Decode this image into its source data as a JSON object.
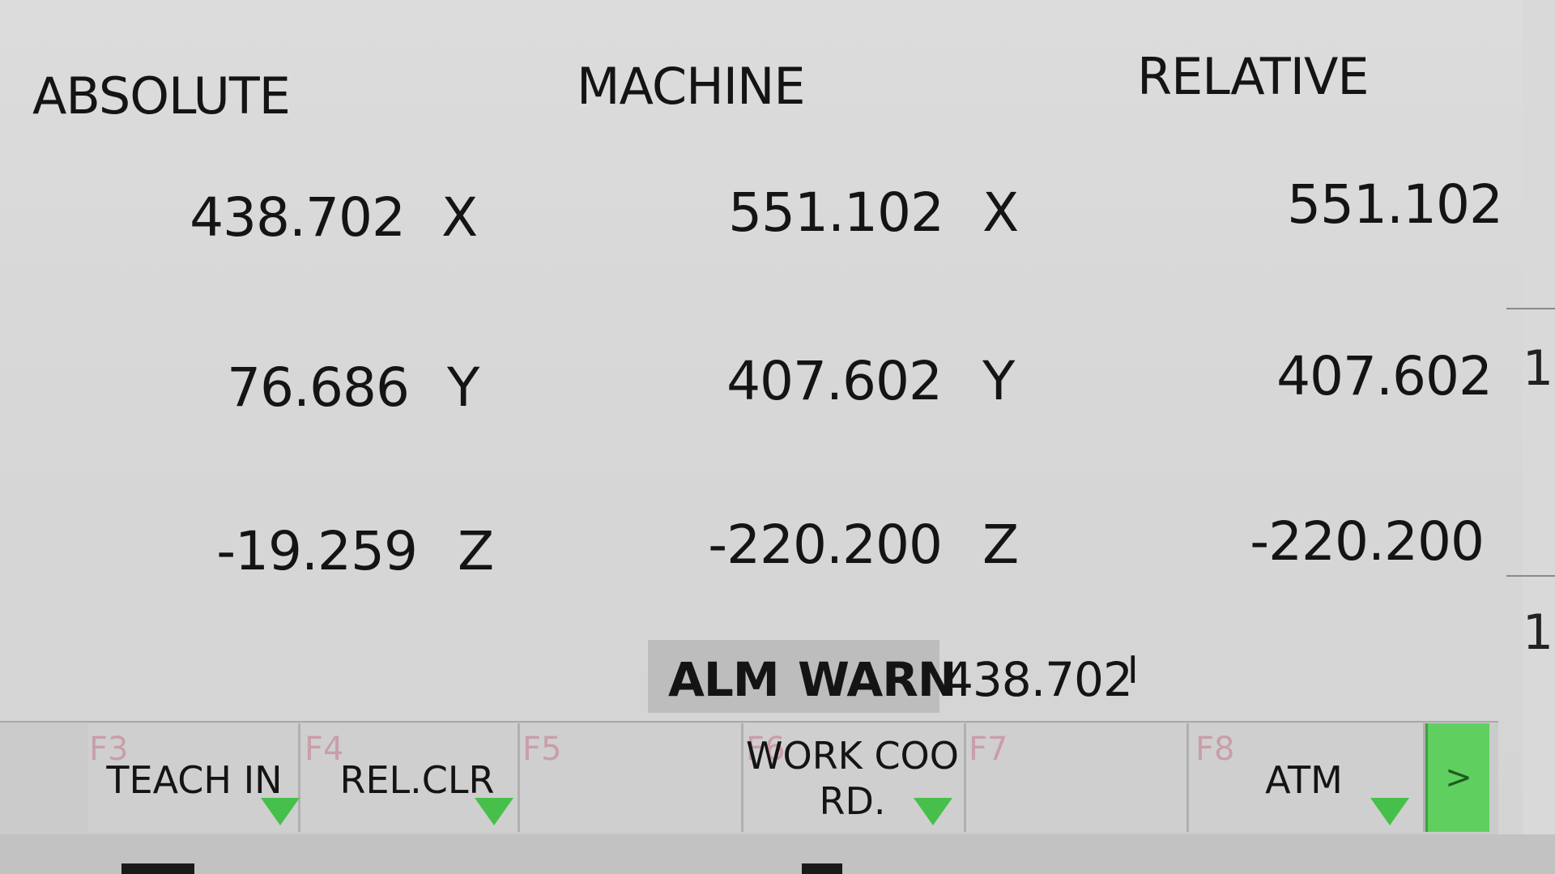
{
  "headers": {
    "absolute": "ABSOLUTE",
    "machine": "MACHINE",
    "relative": "RELATIVE"
  },
  "rows": [
    {
      "abs": "438.702",
      "abs_axis": "X",
      "mac": "551.102",
      "mac_axis": "X",
      "rel": "551.102"
    },
    {
      "abs": "76.686",
      "abs_axis": "Y",
      "mac": "407.602",
      "mac_axis": "Y",
      "rel": "407.602"
    },
    {
      "abs": "-19.259",
      "abs_axis": "Z",
      "mac": "-220.200",
      "mac_axis": "Z",
      "rel": "-220.200"
    }
  ],
  "status": {
    "alm": "ALM",
    "warn": "WARN",
    "value": "438.702",
    "cursor": "I"
  },
  "softkeys": [
    {
      "fkey": "F3",
      "label": "TEACH IN",
      "arrow": true
    },
    {
      "fkey": "F4",
      "label": "REL.CLR",
      "arrow": true
    },
    {
      "fkey": "F5",
      "label": "",
      "arrow": false
    },
    {
      "fkey": "F6",
      "label": "WORK COO\nRD.",
      "arrow": true
    },
    {
      "fkey": "F7",
      "label": "",
      "arrow": false
    },
    {
      "fkey": "F8",
      "label": "ATM",
      "arrow": true
    }
  ],
  "next_label": ">",
  "edge_glyphs": [
    "1",
    "1"
  ],
  "colors": {
    "background": "#d9d9d9",
    "fkey_text": "#c99ea9",
    "arrow_green": "#46c04a",
    "next_button": "#5fcf5f"
  }
}
